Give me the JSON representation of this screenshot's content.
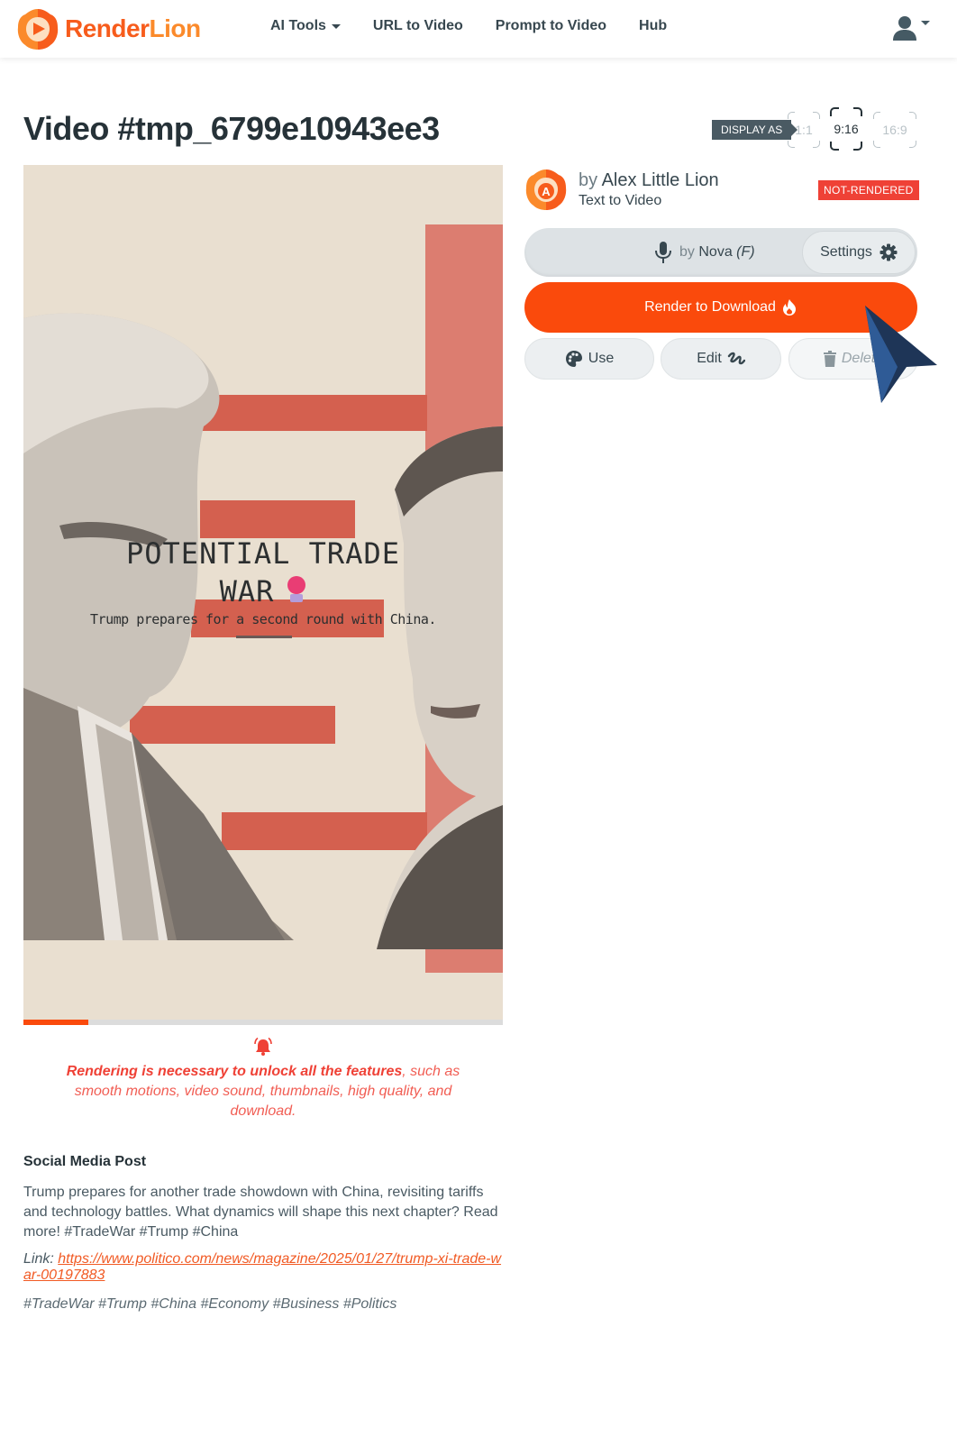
{
  "header": {
    "brand": {
      "part1": "Render",
      "part2": "Lion"
    },
    "nav": [
      {
        "label": "AI Tools",
        "has_dropdown": true
      },
      {
        "label": "URL to Video"
      },
      {
        "label": "Prompt to Video"
      },
      {
        "label": "Hub"
      }
    ],
    "user_menu_icon": "user-icon"
  },
  "page": {
    "title": "Video #tmp_6799e10943ee3",
    "display_as_label": "DISPLAY AS",
    "ratios": [
      {
        "label": "1:1",
        "active": false
      },
      {
        "label": "9:16",
        "active": true
      },
      {
        "label": "16:9",
        "active": false
      }
    ]
  },
  "video": {
    "title_line1": "POTENTIAL TRADE",
    "title_line2": "WAR",
    "title_emoji": "boxing-glove-icon",
    "subtitle": "Trump prepares for a second round with China.",
    "progress_percent": 13.5,
    "colors": {
      "background": "#e9dfd0",
      "accent_bar": "#d4604f",
      "progress": "#fa4a0c"
    }
  },
  "notice": {
    "icon": "bell-icon",
    "bold_text": "Rendering is necessary to unlock all the features",
    "rest_text": ", such as smooth motions, video sound, thumbnails, high quality, and download."
  },
  "social": {
    "heading": "Social Media Post",
    "body": "Trump prepares for another trade showdown with China, revisiting tariffs and technology battles. What dynamics will shape this next chapter? Read more! #TradeWar #Trump #China",
    "link_label": "Link: ",
    "link_url": "https://www.politico.com/news/magazine/2025/01/27/trump-xi-trade-war-00197883",
    "hashtags": "#TradeWar #Trump #China #Economy #Business #Politics"
  },
  "panel": {
    "author_by": "by",
    "author_name": "Alex Little Lion",
    "author_type": "Text to Video",
    "status_badge": "NOT-RENDERED",
    "voice_by": "by",
    "voice_name": "Nova",
    "voice_gender": "(F)",
    "settings_label": "Settings",
    "render_label": "Render to Download",
    "use_label": "Use",
    "edit_label": "Edit",
    "delete_label": "Delete",
    "colors": {
      "primary": "#fa4a0c",
      "badge": "#ef4136"
    }
  }
}
